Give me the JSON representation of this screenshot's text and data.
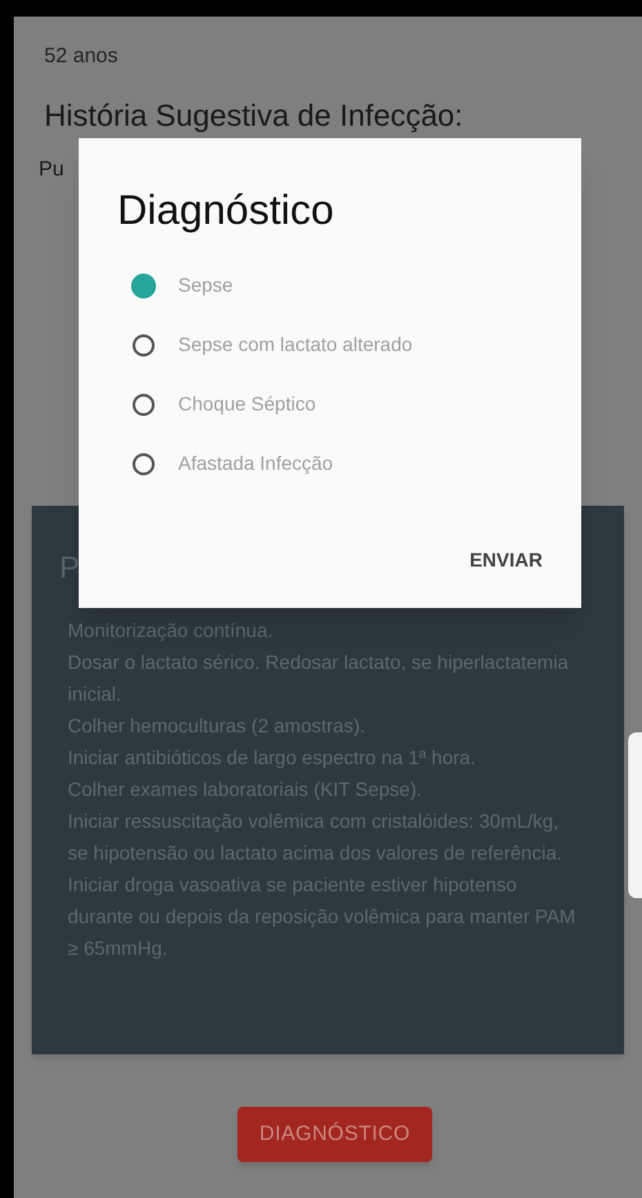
{
  "page": {
    "age": "52 anos",
    "history_heading": "História Sugestiva de Infecção:",
    "history_text": "Pu",
    "card": {
      "title": "P",
      "lines": [
        "Monitorização contínua.",
        "Dosar o lactato sérico. Redosar lactato, se hiperlactatemia inicial.",
        "Colher hemoculturas (2 amostras).",
        "Iniciar antibióticos de largo espectro na 1ª hora.",
        "Colher exames laboratoriais (KIT Sepse).",
        "Iniciar ressuscitação volêmica com cristalóides: 30mL/kg, se hipotensão ou lactato acima dos valores de referência.",
        "Iniciar droga vasoativa se paciente estiver hipotenso durante ou depois da reposição volêmica para manter PAM ≥ 65mmHg."
      ]
    },
    "button": "DIAGNÓSTICO"
  },
  "dialog": {
    "title": "Diagnóstico",
    "options": [
      {
        "label": "Sepse",
        "selected": true
      },
      {
        "label": "Sepse com lactato alterado",
        "selected": false
      },
      {
        "label": "Choque Séptico",
        "selected": false
      },
      {
        "label": "Afastada Infecção",
        "selected": false
      }
    ],
    "action": "ENVIAR"
  }
}
